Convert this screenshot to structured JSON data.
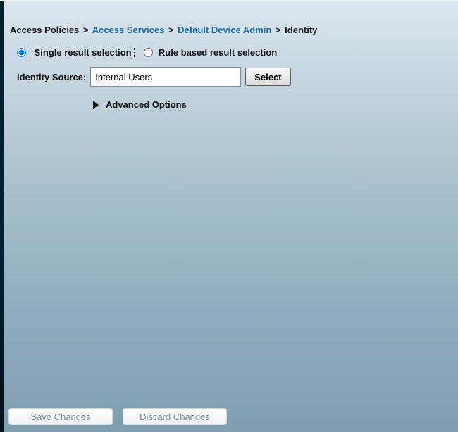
{
  "breadcrumb": {
    "root": "Access Policies",
    "links": [
      "Access Services",
      "Default Device Admin"
    ],
    "current": "Identity",
    "sep": ">"
  },
  "form": {
    "radio": {
      "single": "Single result selection",
      "rule": "Rule based result selection",
      "selected": "single"
    },
    "identity_source_label": "Identity Source:",
    "identity_source_value": "Internal Users",
    "select_button": "Select",
    "advanced_label": "Advanced Options"
  },
  "footer": {
    "save": "Save Changes",
    "discard": "Discard Changes"
  }
}
